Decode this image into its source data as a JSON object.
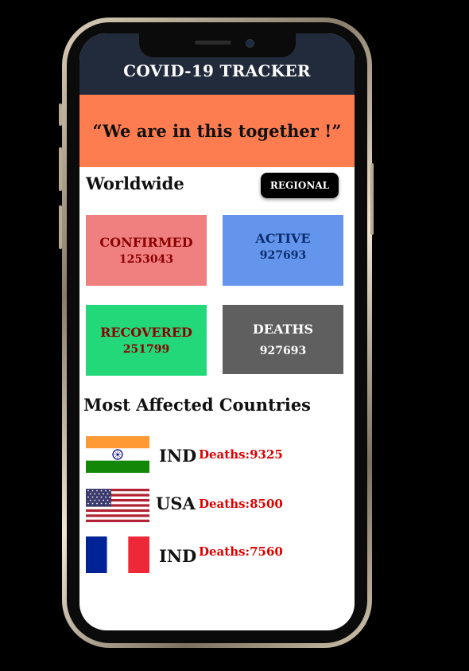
{
  "app": {
    "title": "COVID-19 TRACKER"
  },
  "banner": {
    "text": "“We are in this together !”"
  },
  "worldwide": {
    "label": "Worldwide",
    "regional_button": "REGIONAL"
  },
  "stats": [
    {
      "title": "CONFIRMED",
      "value": "1253043",
      "bg": "#f08080",
      "color": "#8b0000"
    },
    {
      "title": "ACTIVE",
      "value": "927693",
      "bg": "#6495ed",
      "color": "#0b2c6b"
    },
    {
      "title": "RECOVERED",
      "value": "251799",
      "bg": "#22d878",
      "color": "#8b0000"
    },
    {
      "title": "DEATHS",
      "value": "927693",
      "bg": "#5f5f5f",
      "color": "#ffffff"
    }
  ],
  "most_affected": {
    "title": "Most Affected  Countries",
    "countries": [
      {
        "code": "IND",
        "deaths": "Deaths:9325",
        "flag": "india-flag"
      },
      {
        "code": "USA",
        "deaths": "Deaths:8500",
        "flag": "usa-flag"
      },
      {
        "code": "IND",
        "deaths": "Deaths:7560",
        "flag": "france-flag"
      }
    ]
  },
  "colors": {
    "header_bg": "#222b3b",
    "banner_bg": "#fd7d50",
    "deaths_text": "#e00000"
  }
}
